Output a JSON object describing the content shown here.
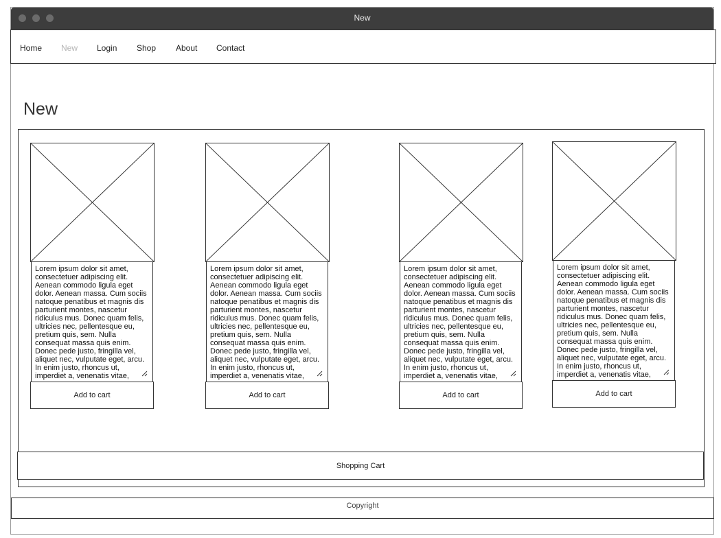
{
  "window": {
    "title": "New"
  },
  "nav": {
    "items": [
      {
        "label": "Home",
        "active": false
      },
      {
        "label": "New",
        "active": true
      },
      {
        "label": "Login",
        "active": false
      },
      {
        "label": "Shop",
        "active": false
      },
      {
        "label": "About",
        "active": false
      },
      {
        "label": "Contact",
        "active": false
      }
    ]
  },
  "page": {
    "title": "New"
  },
  "products": [
    {
      "description": "Lorem ipsum dolor sit amet, consectetuer adipiscing elit. Aenean commodo ligula eget dolor. Aenean massa. Cum sociis natoque penatibus et magnis dis parturient montes, nascetur ridiculus mus. Donec quam felis, ultricies nec, pellentesque eu, pretium quis, sem. Nulla consequat massa quis enim. Donec pede justo, fringilla vel, aliquet nec, vulputate eget, arcu. In enim justo, rhoncus ut, imperdiet a, venenatis vitae,",
      "button": "Add to cart"
    },
    {
      "description": "Lorem ipsum dolor sit amet, consectetuer adipiscing elit. Aenean commodo ligula eget dolor. Aenean massa. Cum sociis natoque penatibus et magnis dis parturient montes, nascetur ridiculus mus. Donec quam felis, ultricies nec, pellentesque eu, pretium quis, sem. Nulla consequat massa quis enim. Donec pede justo, fringilla vel, aliquet nec, vulputate eget, arcu. In enim justo, rhoncus ut, imperdiet a, venenatis vitae,",
      "button": "Add to cart"
    },
    {
      "description": "Lorem ipsum dolor sit amet, consectetuer adipiscing elit. Aenean commodo ligula eget dolor. Aenean massa. Cum sociis natoque penatibus et magnis dis parturient montes, nascetur ridiculus mus. Donec quam felis, ultricies nec, pellentesque eu, pretium quis, sem. Nulla consequat massa quis enim. Donec pede justo, fringilla vel, aliquet nec, vulputate eget, arcu. In enim justo, rhoncus ut, imperdiet a, venenatis vitae,",
      "button": "Add to cart"
    },
    {
      "description": "Lorem ipsum dolor sit amet, consectetuer adipiscing elit. Aenean commodo ligula eget dolor. Aenean massa. Cum sociis natoque penatibus et magnis dis parturient montes, nascetur ridiculus mus. Donec quam felis, ultricies nec, pellentesque eu, pretium quis, sem. Nulla consequat massa quis enim. Donec pede justo, fringilla vel, aliquet nec, vulputate eget, arcu. In enim justo, rhoncus ut, imperdiet a, venenatis vitae,",
      "button": "Add to cart"
    }
  ],
  "shopping_cart": {
    "label": "Shopping Cart"
  },
  "footer": {
    "label": "Copyright"
  },
  "colors": {
    "titlebar": "#3d3d3d",
    "active_nav": "#b5b5b5",
    "border": "#333333"
  }
}
